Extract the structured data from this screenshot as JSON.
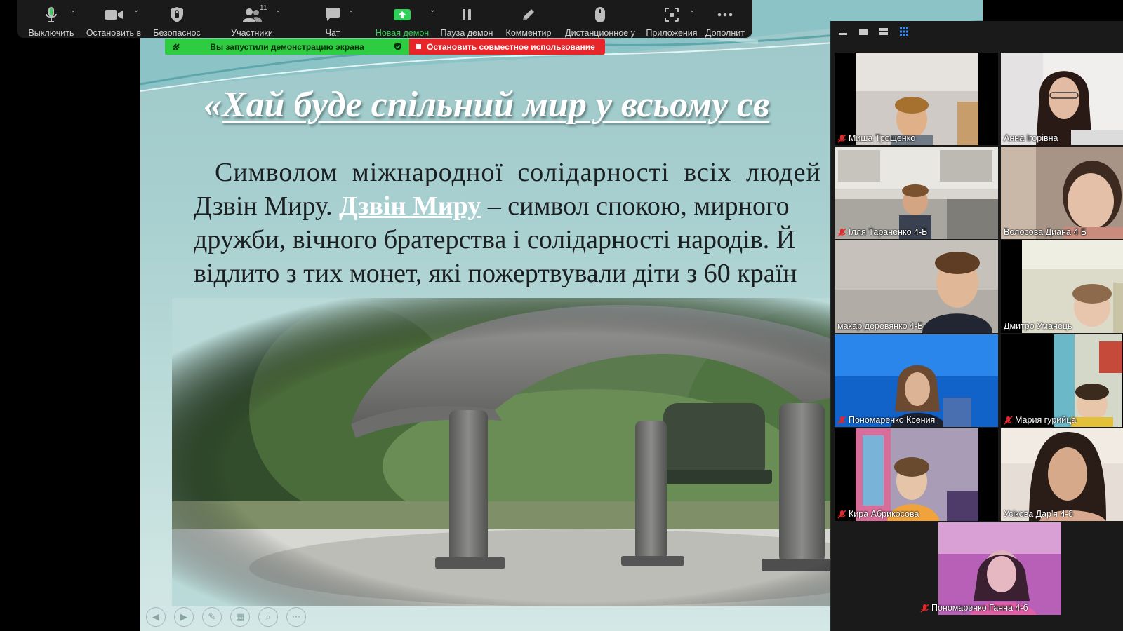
{
  "toolbar": {
    "buttons": [
      {
        "id": "mute",
        "label": "Выключить",
        "icon": "microphone-icon",
        "caret": true
      },
      {
        "id": "video",
        "label": "Остановить в",
        "icon": "video-camera-icon",
        "caret": true
      },
      {
        "id": "security",
        "label": "Безопаснос",
        "icon": "shield-icon",
        "caret": false
      },
      {
        "id": "participants",
        "label": "Участники",
        "icon": "participants-icon",
        "caret": true,
        "count": "11"
      },
      {
        "id": "chat",
        "label": "Чат",
        "icon": "chat-bubble-icon",
        "caret": true
      },
      {
        "id": "new-share",
        "label": "Новая демон",
        "icon": "share-screen-icon",
        "caret": true
      },
      {
        "id": "pause-share",
        "label": "Пауза демон",
        "icon": "pause-icon",
        "caret": false
      },
      {
        "id": "annotate",
        "label": "Комментир",
        "icon": "pencil-icon",
        "caret": false
      },
      {
        "id": "remote-control",
        "label": "Дистанционное у",
        "icon": "mouse-icon",
        "caret": false
      },
      {
        "id": "apps",
        "label": "Приложения",
        "icon": "apps-icon",
        "caret": true
      },
      {
        "id": "more",
        "label": "Дополнит",
        "icon": "more-dots-icon",
        "caret": false
      }
    ]
  },
  "share_bar": {
    "status": "Вы запустили демонстрацию экрана",
    "stop": "Остановить совместное использование"
  },
  "slide": {
    "title_prefix": "«",
    "title": "Хай буде спільний мир у всьому св",
    "para": {
      "line1": "Символом міжнародної солідарності всіх людей",
      "line2_start": "Дзвін Миру. ",
      "line2_link": "Дзвін Миру",
      "line2_end": " – символ спокою, мирного",
      "line3": "дружби, вічного братерства і солідарності народів. Й",
      "line4": "відлито з тих монет, які пожертвували діти з 60 країн"
    }
  },
  "participants": [
    {
      "name": "Миша Трощенко",
      "muted": true
    },
    {
      "name": "Анна Ігорівна",
      "muted": false
    },
    {
      "name": "Ілля Тараненко 4-Б",
      "muted": true
    },
    {
      "name": "Волосова Диана 4 Б",
      "muted": false
    },
    {
      "name": "макар  деревянко 4-Б",
      "muted": false
    },
    {
      "name": "Дмитро Уманець",
      "muted": false
    },
    {
      "name": "Пономаренко Ксения",
      "muted": true
    },
    {
      "name": "Мария гурийца",
      "muted": true
    },
    {
      "name": "Кира Абрикосова",
      "muted": true
    },
    {
      "name": "Усікова Дар'я 4-б",
      "muted": false
    },
    {
      "name": "Пономаренко Ганна 4-б",
      "muted": true
    }
  ],
  "colors": {
    "toolbar_bg": "#1a1a1a",
    "share_green": "#2ecc40",
    "share_red": "#e8262a",
    "active_speaker": "#c8d63e",
    "mic_off": "#e8262a"
  }
}
